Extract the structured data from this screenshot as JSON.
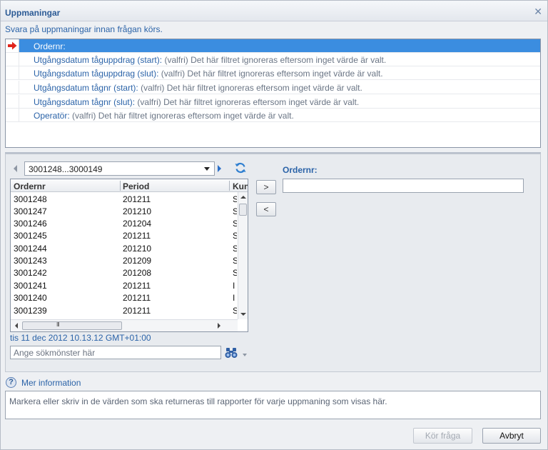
{
  "dialog": {
    "title": "Uppmaningar",
    "subtitle": "Svara på uppmaningar innan frågan körs."
  },
  "prompts": [
    {
      "label": "Ordernr:",
      "desc": ""
    },
    {
      "label": "Utgångsdatum tåguppdrag (start):",
      "desc": " (valfri) Det här filtret ignoreras eftersom inget värde är valt."
    },
    {
      "label": "Utgångsdatum tåguppdrag (slut):",
      "desc": " (valfri) Det här filtret ignoreras eftersom inget värde är valt."
    },
    {
      "label": "Utgångsdatum tågnr (start):",
      "desc": " (valfri) Det här filtret ignoreras eftersom inget värde är valt."
    },
    {
      "label": "Utgångsdatum tågnr (slut):",
      "desc": " (valfri) Det här filtret ignoreras eftersom inget värde är valt."
    },
    {
      "label": "Operatör:",
      "desc": " (valfri) Det här filtret ignoreras eftersom inget värde är valt."
    }
  ],
  "values_panel": {
    "range": "3001248...3000149",
    "columns": [
      "Ordernr",
      "Period",
      "Kun"
    ],
    "rows": [
      [
        "3001248",
        "201211",
        "S"
      ],
      [
        "3001247",
        "201210",
        "S"
      ],
      [
        "3001246",
        "201204",
        "S"
      ],
      [
        "3001245",
        "201211",
        "S"
      ],
      [
        "3001244",
        "201210",
        "S"
      ],
      [
        "3001243",
        "201209",
        "S"
      ],
      [
        "3001242",
        "201208",
        "S"
      ],
      [
        "3001241",
        "201211",
        "I"
      ],
      [
        "3001240",
        "201211",
        "I"
      ],
      [
        "3001239",
        "201211",
        "S"
      ]
    ],
    "scroll_grip": "III",
    "timestamp": "tis 11 dec 2012 10.13.12 GMT+01:00",
    "search_placeholder": "Ange sökmönster här",
    "add_label": ">",
    "remove_label": "<"
  },
  "selected": {
    "label": "Ordernr:",
    "value": ""
  },
  "info": {
    "link": "Mer information",
    "text": "Markera eller skriv in de värden som ska returneras till rapporter för varje uppmaning som visas här."
  },
  "footer": {
    "run": "Kör fråga",
    "cancel": "Avbryt"
  },
  "colors": {
    "accent": "#2b63a8",
    "selection": "#3b8de0",
    "arrow": "#e0241b"
  }
}
